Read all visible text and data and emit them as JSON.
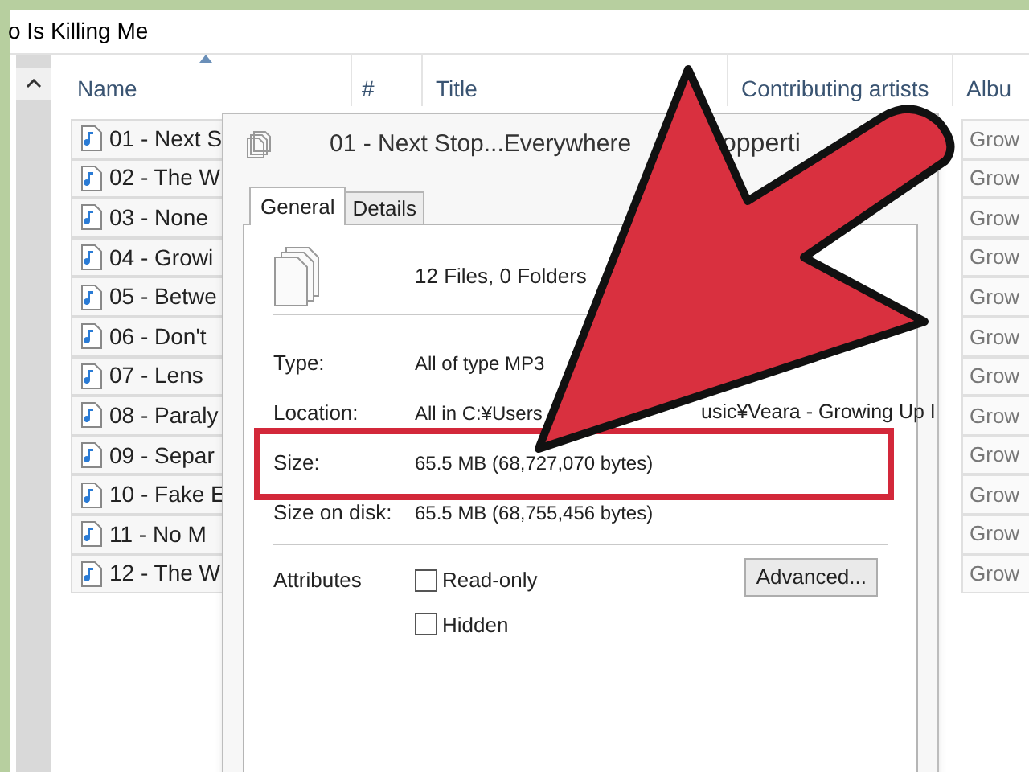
{
  "explorer": {
    "title": "o Is Killing Me",
    "columns": [
      {
        "label": "Name",
        "sorted": true
      },
      {
        "label": "#",
        "sorted": false
      },
      {
        "label": "Title",
        "sorted": false
      },
      {
        "label": "Contributing artists",
        "sorted": false
      },
      {
        "label": "Albu",
        "sorted": false
      }
    ],
    "rows": [
      {
        "name": "01 - Next S",
        "album": "Grow"
      },
      {
        "name": "02 - The W",
        "album": "Grow"
      },
      {
        "name": "03 - None",
        "album": "Grow"
      },
      {
        "name": "04 - Growi",
        "album": "Grow"
      },
      {
        "name": "05 - Betwe",
        "album": "Grow"
      },
      {
        "name": "06 - Don't",
        "album": "Grow"
      },
      {
        "name": "07 - Lens",
        "album": "Grow"
      },
      {
        "name": "08 - Paraly",
        "album": "Grow"
      },
      {
        "name": "09 - Separ",
        "album": "Grow"
      },
      {
        "name": "10 - Fake E",
        "album": "Grow"
      },
      {
        "name": "11 - No M",
        "album": "Grow"
      },
      {
        "name": "12 - The W",
        "album": "Grow"
      }
    ]
  },
  "dialog": {
    "title": "01 - Next Stop...Everywhere",
    "title_tail": "opperti",
    "tabs": [
      {
        "label": "General",
        "selected": true
      },
      {
        "label": "Details",
        "selected": false
      }
    ],
    "summary": "12 Files, 0 Folders",
    "fields": [
      {
        "label": "Type:",
        "value": "All of type MP3",
        "highlighted": false
      },
      {
        "label": "Location:",
        "value": "All in C:¥Users",
        "value_tail": "usic¥Veara - Growing Up I",
        "highlighted": false
      },
      {
        "label": "Size:",
        "value": "65.5 MB (68,727,070 bytes)",
        "highlighted": true
      },
      {
        "label": "Size on disk:",
        "value": "65.5 MB (68,755,456 bytes)",
        "highlighted": false
      }
    ],
    "attributes_label": "Attributes",
    "attributes": [
      {
        "label": "Read-only",
        "checked": false
      },
      {
        "label": "Hidden",
        "checked": false
      }
    ],
    "advanced_button": "Advanced..."
  }
}
